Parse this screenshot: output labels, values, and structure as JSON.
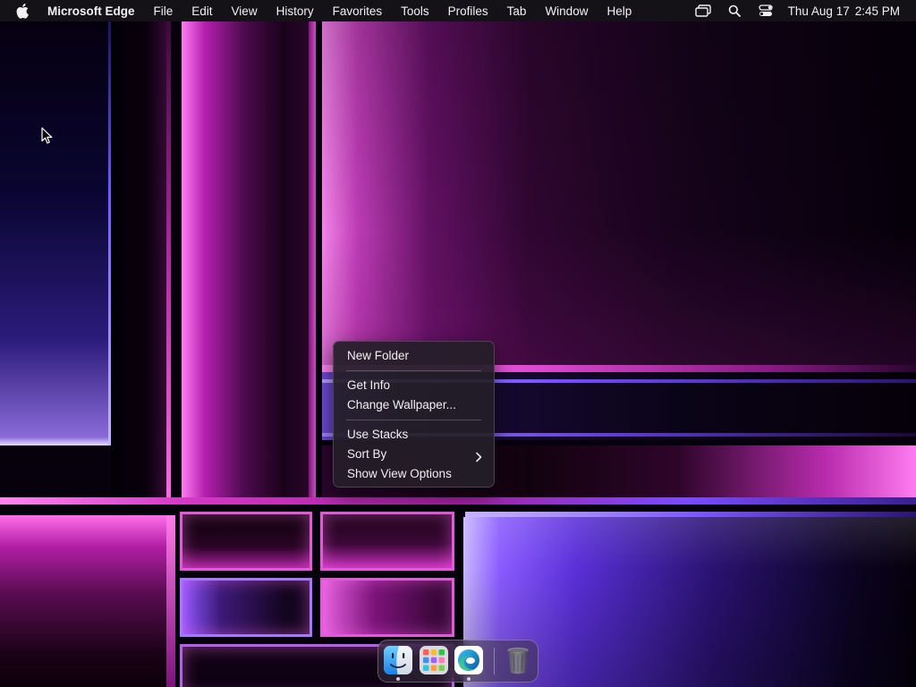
{
  "menubar": {
    "app_name": "Microsoft Edge",
    "menus": [
      "File",
      "Edit",
      "View",
      "History",
      "Favorites",
      "Tools",
      "Profiles",
      "Tab",
      "Window",
      "Help"
    ],
    "status_icons": [
      "screen-mirroring-icon",
      "search-icon",
      "control-center-icon"
    ],
    "date": "Thu Aug 17",
    "time": "2:45 PM"
  },
  "context_menu": {
    "items": [
      {
        "label": "New Folder"
      },
      {
        "label": "Get Info"
      },
      {
        "label": "Change Wallpaper..."
      },
      {
        "label": "Use Stacks"
      },
      {
        "label": "Sort By",
        "submenu": true
      },
      {
        "label": "Show View Options"
      }
    ]
  },
  "dock": {
    "apps": [
      {
        "name": "Finder",
        "icon": "finder-icon",
        "running": true
      },
      {
        "name": "Launchpad",
        "icon": "launchpad-icon",
        "running": false
      },
      {
        "name": "Microsoft Edge",
        "icon": "edge-icon",
        "running": true
      },
      {
        "name": "Trash",
        "icon": "trash-icon",
        "running": false
      }
    ]
  },
  "colors": {
    "accent_pink": "#ff7cf0",
    "accent_violet": "#7e5bff",
    "menu_bg": "#241e28"
  }
}
